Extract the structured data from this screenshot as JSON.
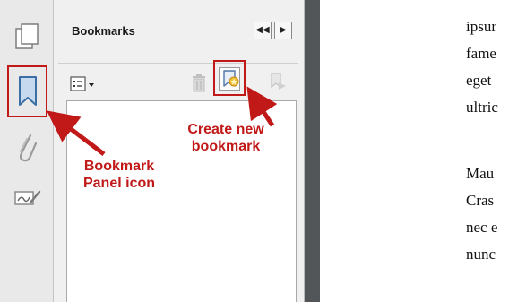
{
  "panel": {
    "title": "Bookmarks",
    "collapse_label": "◀◀",
    "expand_label": "▶"
  },
  "rail": {
    "icons": [
      "pages-icon",
      "bookmark-panel-icon",
      "attachments-icon",
      "signatures-icon"
    ]
  },
  "toolbar": {
    "options_icon": "options-menu-icon",
    "delete_icon": "delete-bookmark-icon",
    "new_bookmark_icon": "new-bookmark-icon",
    "expand_bookmark_icon": "expand-current-bookmark-icon"
  },
  "document": {
    "lines": [
      "ipsur",
      "fame",
      "eget",
      "ultric",
      "Mau",
      "Cras",
      "nec e",
      "nunc"
    ]
  },
  "annotations": {
    "create_new_bookmark": [
      "Create new",
      "bookmark"
    ],
    "bookmark_panel_icon": [
      "Bookmark",
      "Panel icon"
    ]
  },
  "colors": {
    "annotation_red": "#c11818",
    "gutter": "#525659",
    "panel_bg": "#f0f0f0"
  }
}
